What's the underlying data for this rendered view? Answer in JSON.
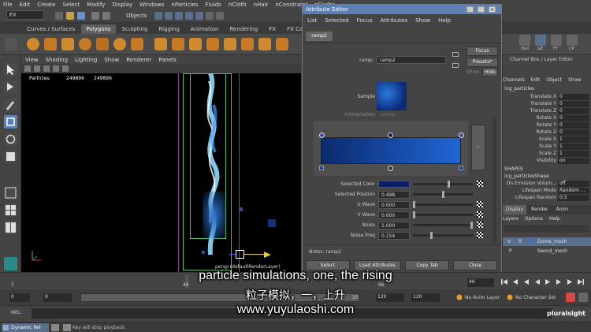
{
  "menubar": [
    "File",
    "Edit",
    "Create",
    "Select",
    "Modify",
    "Display",
    "Windows",
    "nParticles",
    "Fluids",
    "nCloth",
    "nHair",
    "nConstraint",
    "nCache"
  ],
  "statusline": {
    "mode": "FX",
    "objects_label": "Objects"
  },
  "shelf": {
    "tabs": [
      "Curves / Surfaces",
      "Polygons",
      "Sculpting",
      "Rigging",
      "Animation",
      "Rendering",
      "FX",
      "FX Caching"
    ],
    "active_tab": "Polygons"
  },
  "viewport": {
    "menu": [
      "View",
      "Shading",
      "Lighting",
      "Show",
      "Renderer",
      "Panels"
    ],
    "hud_label": "Particles:",
    "hud_values": [
      "249896",
      "249896"
    ],
    "camera_label": "persp (defaultRenderLayer)"
  },
  "attribute_editor": {
    "title": "Attribute Editor",
    "menu": [
      "List",
      "Selected",
      "Focus",
      "Attributes",
      "Show",
      "Help"
    ],
    "tab": "ramp2",
    "ramp_label": "ramp:",
    "ramp_value": "ramp2",
    "focus_button": "Focus",
    "presets_button": "Presets*",
    "show_button": "Show",
    "hide_button": "Hide",
    "sample_label": "Sample",
    "interpolation_label": "Interpolation",
    "interpolation_value": "Linear",
    "rows": [
      {
        "label": "Selected Color",
        "value": "",
        "slider": 0.6
      },
      {
        "label": "Selected Position",
        "value": "0.498",
        "slider": 0.5
      },
      {
        "label": "U Wave",
        "value": "0.000",
        "slider": 0.0
      },
      {
        "label": "V Wave",
        "value": "0.000",
        "slider": 0.0
      },
      {
        "label": "Noise",
        "value": "1.000",
        "slider": 1.0
      },
      {
        "label": "Noise Freq",
        "value": "0.154",
        "slider": 0.3
      }
    ],
    "notes_label": "Notes: ramp2",
    "buttons": [
      "Select",
      "Load Attributes",
      "Copy Tab",
      "Close"
    ],
    "colors": {
      "ramp_left": "#0c2a6e",
      "ramp_right": "#1f66d6",
      "selected_color": "#0b1f66"
    }
  },
  "channel_box": {
    "header_tabs": [
      "Channel Box / Layer Editor"
    ],
    "menu": [
      "Channels",
      "Edit",
      "Object",
      "Show"
    ],
    "object": "ing_particles",
    "shelf_labels": [
      "Outl",
      "GE",
      "FT",
      "CP"
    ],
    "channels": [
      {
        "k": "Translate X",
        "v": "0"
      },
      {
        "k": "Translate Y",
        "v": "0"
      },
      {
        "k": "Translate Z",
        "v": "0"
      },
      {
        "k": "Rotate X",
        "v": "0"
      },
      {
        "k": "Rotate Y",
        "v": "0"
      },
      {
        "k": "Rotate Z",
        "v": "0"
      },
      {
        "k": "Scale X",
        "v": "1"
      },
      {
        "k": "Scale Y",
        "v": "1"
      },
      {
        "k": "Scale Z",
        "v": "1"
      },
      {
        "k": "Visibility",
        "v": "on"
      }
    ],
    "shapes_header": "SHAPES",
    "shape_name": "ing_particlesShape",
    "shape_channels": [
      {
        "k": "On Emission Volum...",
        "v": "off"
      },
      {
        "k": "Lifespan Mode",
        "v": "Random ..."
      },
      {
        "k": "Lifespan Random",
        "v": "0.5"
      }
    ],
    "layer_tabs": [
      "Display",
      "Render",
      "Anim"
    ],
    "layer_menu": [
      "Layers",
      "Options",
      "Help"
    ],
    "layers": [
      {
        "v": "V",
        "p": "R",
        "name": "Dome_mesh"
      },
      {
        "v": "",
        "p": "P",
        "name": "Sword_mesh"
      }
    ]
  },
  "timeline": {
    "ticks": [
      "1",
      "46",
      "96"
    ],
    "current_frame": "46",
    "range": {
      "start1": "0",
      "start2": "0",
      "mid": "20",
      "end1": "120",
      "end2": "120",
      "end3": "200"
    },
    "anim_layer": "No Anim Layer",
    "char_set": "No Character Set",
    "mel_label": "MEL",
    "help_text": "Dynamic Rel",
    "help_hint": "Key will stop playback."
  },
  "subtitles": {
    "line1": "particle simulations, one, the rising",
    "line2": "粒子模拟，一，上升",
    "line3": "www.yuyulaoshi.com"
  },
  "watermark": "pluralsight"
}
